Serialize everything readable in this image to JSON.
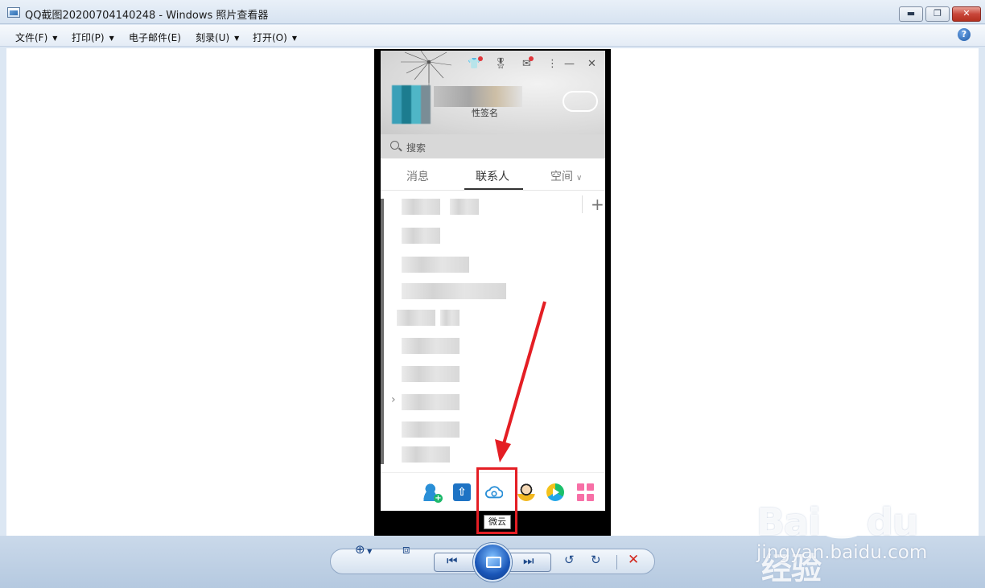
{
  "window": {
    "title": "QQ截图20200704140248 - Windows 照片查看器",
    "minimize": "▬",
    "maximize": "❐",
    "close": "✕"
  },
  "menubar": {
    "items": [
      {
        "label": "文件(F)",
        "has_dropdown": true
      },
      {
        "label": "打印(P)",
        "has_dropdown": true
      },
      {
        "label": "电子邮件(E)",
        "has_dropdown": false
      },
      {
        "label": "刻录(U)",
        "has_dropdown": true
      },
      {
        "label": "打开(O)",
        "has_dropdown": true
      }
    ],
    "help": "?"
  },
  "qq": {
    "signature": "性签名",
    "search_placeholder": "搜索",
    "tabs": [
      {
        "label": "消息",
        "active": false
      },
      {
        "label": "联系人",
        "active": true
      },
      {
        "label": "空间",
        "active": false
      }
    ],
    "add_symbol": "+",
    "footer_icons": [
      "menu-icon",
      "add-contact-icon",
      "transfer-icon",
      "weiyun-icon",
      "game-icon",
      "tencent-video-icon",
      "apps-icon"
    ],
    "tooltip": "微云"
  },
  "watermark": {
    "brand_left": "Bai",
    "brand_right": "du",
    "brand_cn": "经验",
    "url": "jingyan.baidu.com"
  },
  "colors": {
    "highlight": "#e41e24",
    "arrow": "#e41e24"
  }
}
